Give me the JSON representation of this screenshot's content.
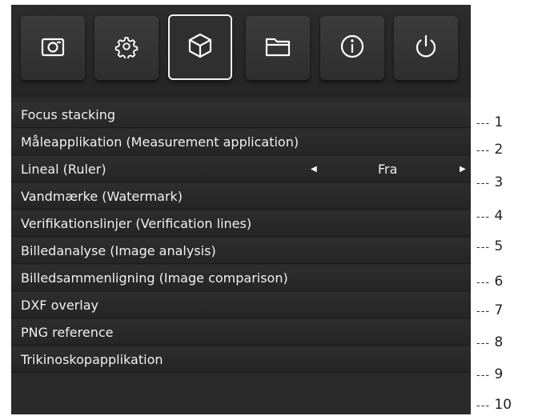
{
  "toolbar": {
    "buttons": [
      {
        "icon": "camera-icon",
        "active": false
      },
      {
        "icon": "gear-icon",
        "active": false
      },
      {
        "icon": "cube-icon",
        "active": true
      },
      {
        "icon": "folder-icon",
        "active": false
      },
      {
        "icon": "info-icon",
        "active": false
      },
      {
        "icon": "power-icon",
        "active": false
      }
    ]
  },
  "menu": {
    "items": [
      {
        "label": "Focus stacking"
      },
      {
        "label": "Måleapplikation (Measurement application)"
      },
      {
        "label": "Lineal (Ruler)",
        "value": "Fra"
      },
      {
        "label": "Vandmærke (Watermark)"
      },
      {
        "label": "Verifikationslinjer (Verification lines)"
      },
      {
        "label": "Billedanalyse (Image analysis)"
      },
      {
        "label": "Billedsammenligning (Image comparison)"
      },
      {
        "label": "DXF overlay"
      },
      {
        "label": "PNG reference"
      },
      {
        "label": "Trikinoskopapplikation"
      }
    ]
  },
  "callouts": {
    "dash": "---",
    "numbers": [
      "1",
      "2",
      "3",
      "4",
      "5",
      "6",
      "7",
      "8",
      "9",
      "10"
    ]
  }
}
